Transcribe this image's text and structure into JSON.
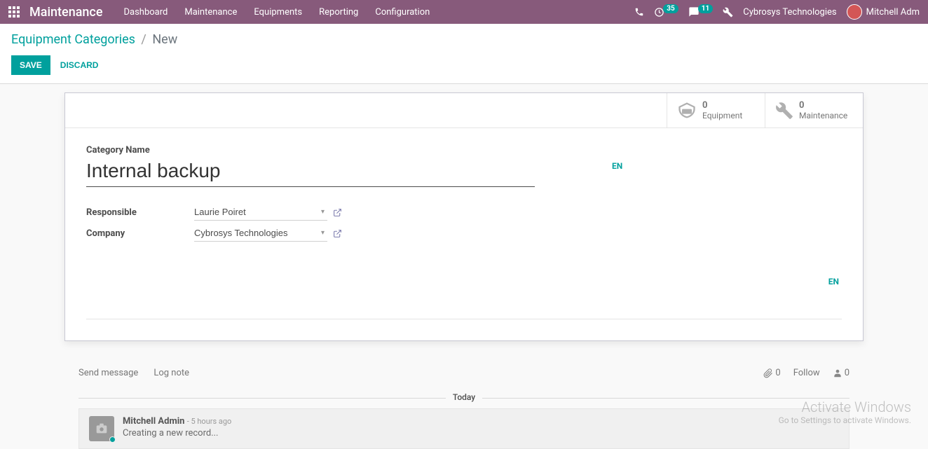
{
  "nav": {
    "title": "Maintenance",
    "items": [
      "Dashboard",
      "Maintenance",
      "Equipments",
      "Reporting",
      "Configuration"
    ],
    "activity_badge": "35",
    "message_badge": "11",
    "company": "Cybrosys Technologies",
    "user": "Mitchell Adm"
  },
  "breadcrumb": {
    "parent": "Equipment Categories",
    "current": "New"
  },
  "buttons": {
    "save": "Save",
    "discard": "Discard"
  },
  "stats": {
    "equipment_count": "0",
    "equipment_label": "Equipment",
    "maintenance_count": "0",
    "maintenance_label": "Maintenance"
  },
  "form": {
    "cat_label": "Category Name",
    "cat_value": "Internal backup",
    "lang_btn": "EN",
    "responsible_label": "Responsible",
    "responsible_value": "Laurie Poiret",
    "company_label": "Company",
    "company_value": "Cybrosys Technologies"
  },
  "chatter": {
    "send": "Send message",
    "log": "Log note",
    "attach_count": "0",
    "follow": "Follow",
    "followers": "0",
    "today": "Today",
    "msg_author": "Mitchell Admin",
    "msg_time": "- 5 hours ago",
    "msg_text": "Creating a new record..."
  },
  "watermark": {
    "line1": "Activate Windows",
    "line2": "Go to Settings to activate Windows."
  }
}
